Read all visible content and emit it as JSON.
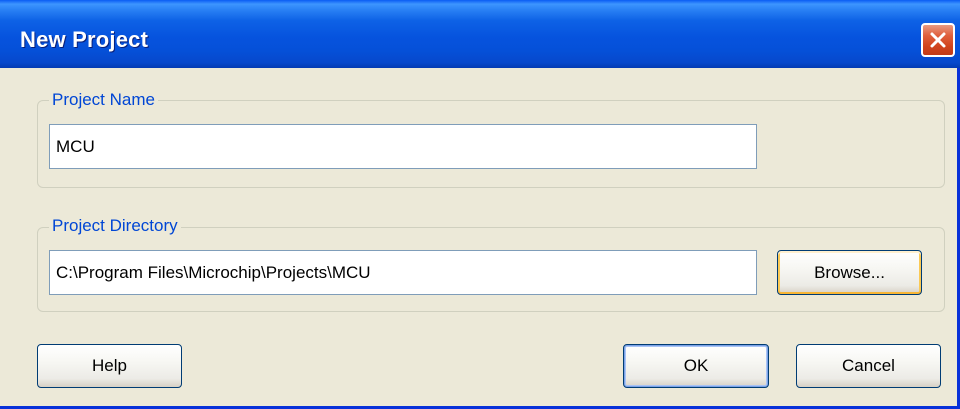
{
  "window": {
    "title": "New Project",
    "close_icon": "close-icon"
  },
  "project_name": {
    "label": "Project Name",
    "value": "MCU"
  },
  "project_directory": {
    "label": "Project Directory",
    "value": "C:\\Program Files\\Microchip\\Projects\\MCU",
    "browse_label": "Browse..."
  },
  "buttons": {
    "help_label": "Help",
    "ok_label": "OK",
    "cancel_label": "Cancel"
  },
  "colors": {
    "titlebar": "#0653DE",
    "dialog_bg": "#ECE9D8",
    "group_label": "#0046D5",
    "close_button": "#D1441D"
  }
}
